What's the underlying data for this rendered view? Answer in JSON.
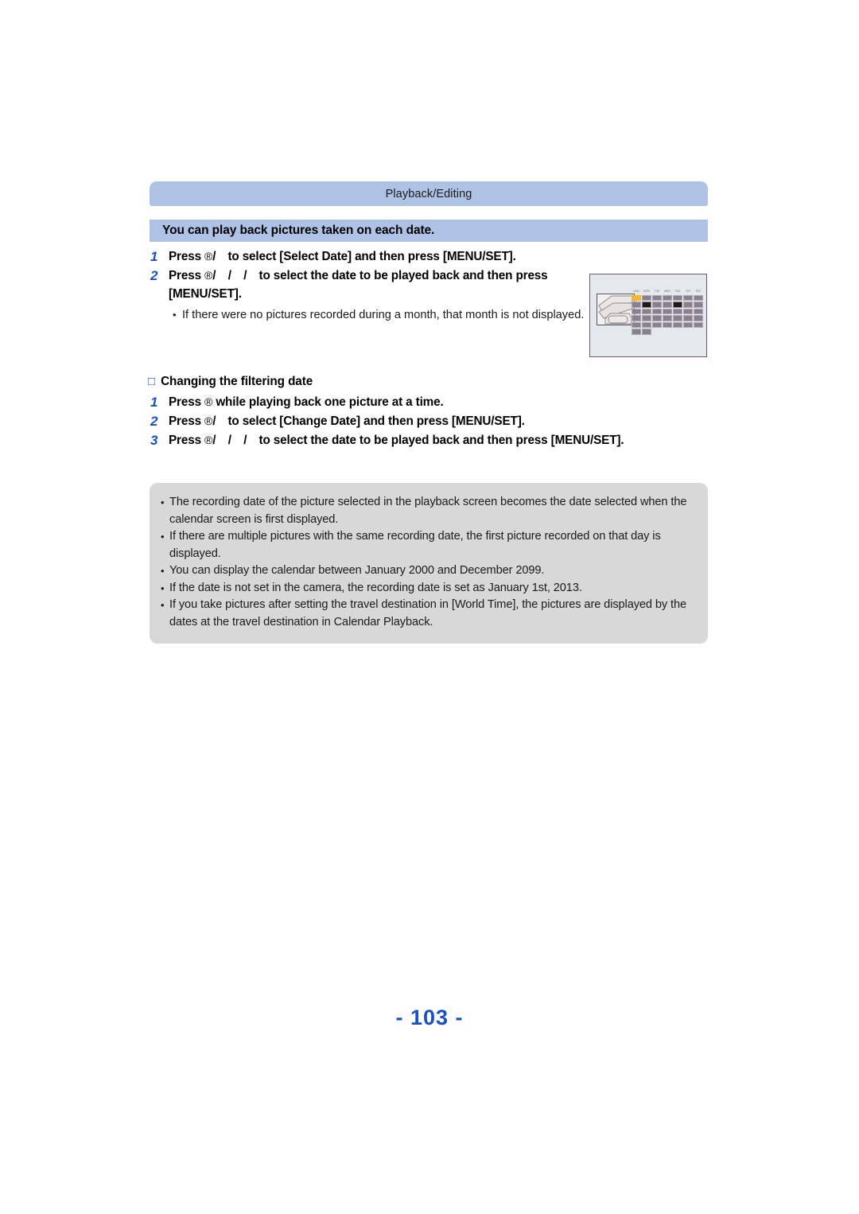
{
  "section": {
    "bar_label": "Playback/Editing",
    "title": "You can play back pictures taken on each date."
  },
  "steps_main": [
    {
      "num": "1",
      "prefix": "Press ",
      "glyph": "®",
      "keys": "/",
      "text": "to select [Select Date] and then press [MENU/SET]."
    },
    {
      "num": "2",
      "prefix": "Press ",
      "glyph": "®",
      "keys": "/ / /",
      "text": "to select the date to be played back and then press [MENU/SET].",
      "bullets": [
        "If there were no pictures recorded during a month, that month is not displayed."
      ]
    }
  ],
  "subheading": {
    "box": "□",
    "label": "Changing the filtering date"
  },
  "steps_filter": [
    {
      "num": "1",
      "prefix": "Press ",
      "glyph": "®",
      "keys": "",
      "text": "while playing back one picture at a time."
    },
    {
      "num": "2",
      "prefix": "Press ",
      "glyph": "®",
      "keys": "/",
      "text": "to select [Change Date] and then press [MENU/SET]."
    },
    {
      "num": "3",
      "prefix": "Press ",
      "glyph": "®",
      "keys": "/ / /",
      "text": "to select the date to be played back and then press [MENU/SET]."
    }
  ],
  "notes": [
    "The recording date of the picture selected in the playback screen becomes the date selected when the calendar screen is first displayed.",
    "If there are multiple pictures with the same recording date, the first picture recorded on that day is displayed.",
    "You can display the calendar between January 2000 and December 2099.",
    "If the date is not set in the camera, the recording date is set as January 1st, 2013.",
    "If you take pictures after setting the travel destination in [World Time], the pictures are displayed by the dates at the travel destination in Calendar Playback."
  ],
  "calendar_screen": {
    "day_headers": [
      "SUN",
      "MON",
      "TUE",
      "WED",
      "THU",
      "FRI",
      "SAT"
    ],
    "rows": [
      [
        "sel",
        "cell",
        "cell",
        "cell",
        "cell",
        "cell",
        "cell"
      ],
      [
        "cell",
        "pic",
        "cell",
        "cell",
        "pic",
        "cell",
        "cell"
      ],
      [
        "cell",
        "cell",
        "cell",
        "cell",
        "cell",
        "cell",
        "cell"
      ],
      [
        "cell",
        "cell",
        "cell",
        "cell",
        "cell",
        "cell",
        "cell"
      ],
      [
        "cell",
        "cell",
        "cell",
        "cell",
        "cell",
        "cell",
        "cell"
      ],
      [
        "cell",
        "cell",
        "blank",
        "blank",
        "blank",
        "blank",
        "blank"
      ]
    ]
  },
  "page_number": "- 103 -",
  "colors": {
    "header_blue": "#aec2e6",
    "accent_blue": "#1a4fc4",
    "note_gray": "#d8d8d8",
    "selected_cell": "#f5b731"
  }
}
